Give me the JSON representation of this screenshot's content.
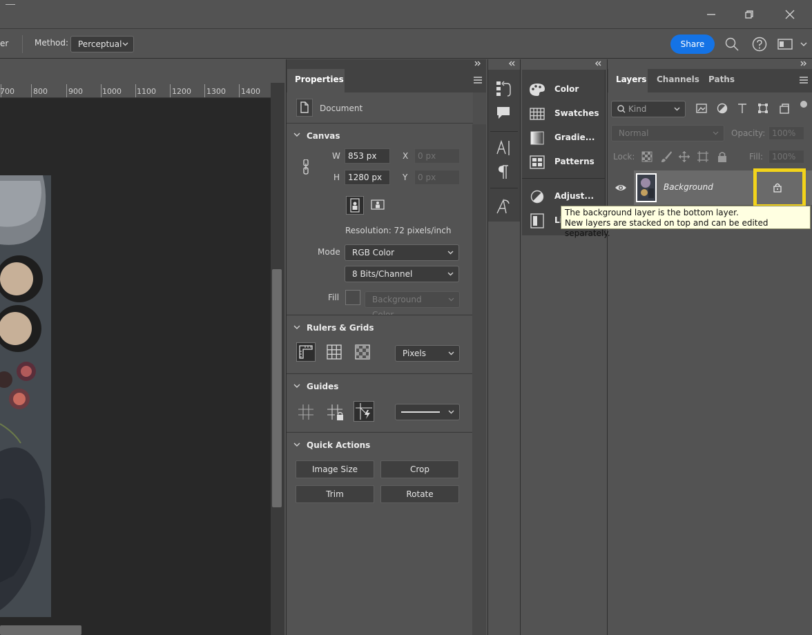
{
  "titlebar": {
    "minimize_icon": "minimize-icon",
    "restore_icon": "restore-icon",
    "close_icon": "close-icon"
  },
  "options": {
    "partial_label": "er",
    "method_label": "Method:",
    "method_value": "Perceptual",
    "share_label": "Share"
  },
  "ruler": {
    "ticks": [
      "700",
      "800",
      "900",
      "1000",
      "1100",
      "1200",
      "1300",
      "1400"
    ]
  },
  "properties": {
    "tab": "Properties",
    "document_label": "Document",
    "canvas": {
      "title": "Canvas",
      "w_label": "W",
      "w_value": "853 px",
      "h_label": "H",
      "h_value": "1280 px",
      "x_label": "X",
      "x_value": "0 px",
      "y_label": "Y",
      "y_value": "0 px",
      "resolution": "Resolution: 72 pixels/inch",
      "mode_label": "Mode",
      "mode_value": "RGB Color",
      "bits_value": "8 Bits/Channel",
      "fill_label": "Fill",
      "fill_value": "Background Color"
    },
    "rulers": {
      "title": "Rulers & Grids",
      "units_value": "Pixels"
    },
    "guides": {
      "title": "Guides"
    },
    "quick_actions": {
      "title": "Quick Actions",
      "image_size": "Image Size",
      "crop": "Crop",
      "trim": "Trim",
      "rotate": "Rotate"
    }
  },
  "mini_panels": {
    "color": "Color",
    "swatches": "Swatches",
    "gradients": "Gradie...",
    "patterns": "Patterns",
    "adjustments": "Adjust...",
    "libraries": "Li"
  },
  "layers": {
    "tabs": [
      "Layers",
      "Channels",
      "Paths"
    ],
    "kind_placeholder": "Kind",
    "blend_mode": "Normal",
    "opacity_label": "Opacity:",
    "opacity_value": "100%",
    "lock_label": "Lock:",
    "fill_label": "Fill:",
    "fill_value": "100%",
    "layer_name": "Background",
    "tooltip_line1": "The background layer is the bottom layer.",
    "tooltip_line2": "New layers are stacked on top and can be edited separately.",
    "highlight_color": "#f2d31b"
  }
}
